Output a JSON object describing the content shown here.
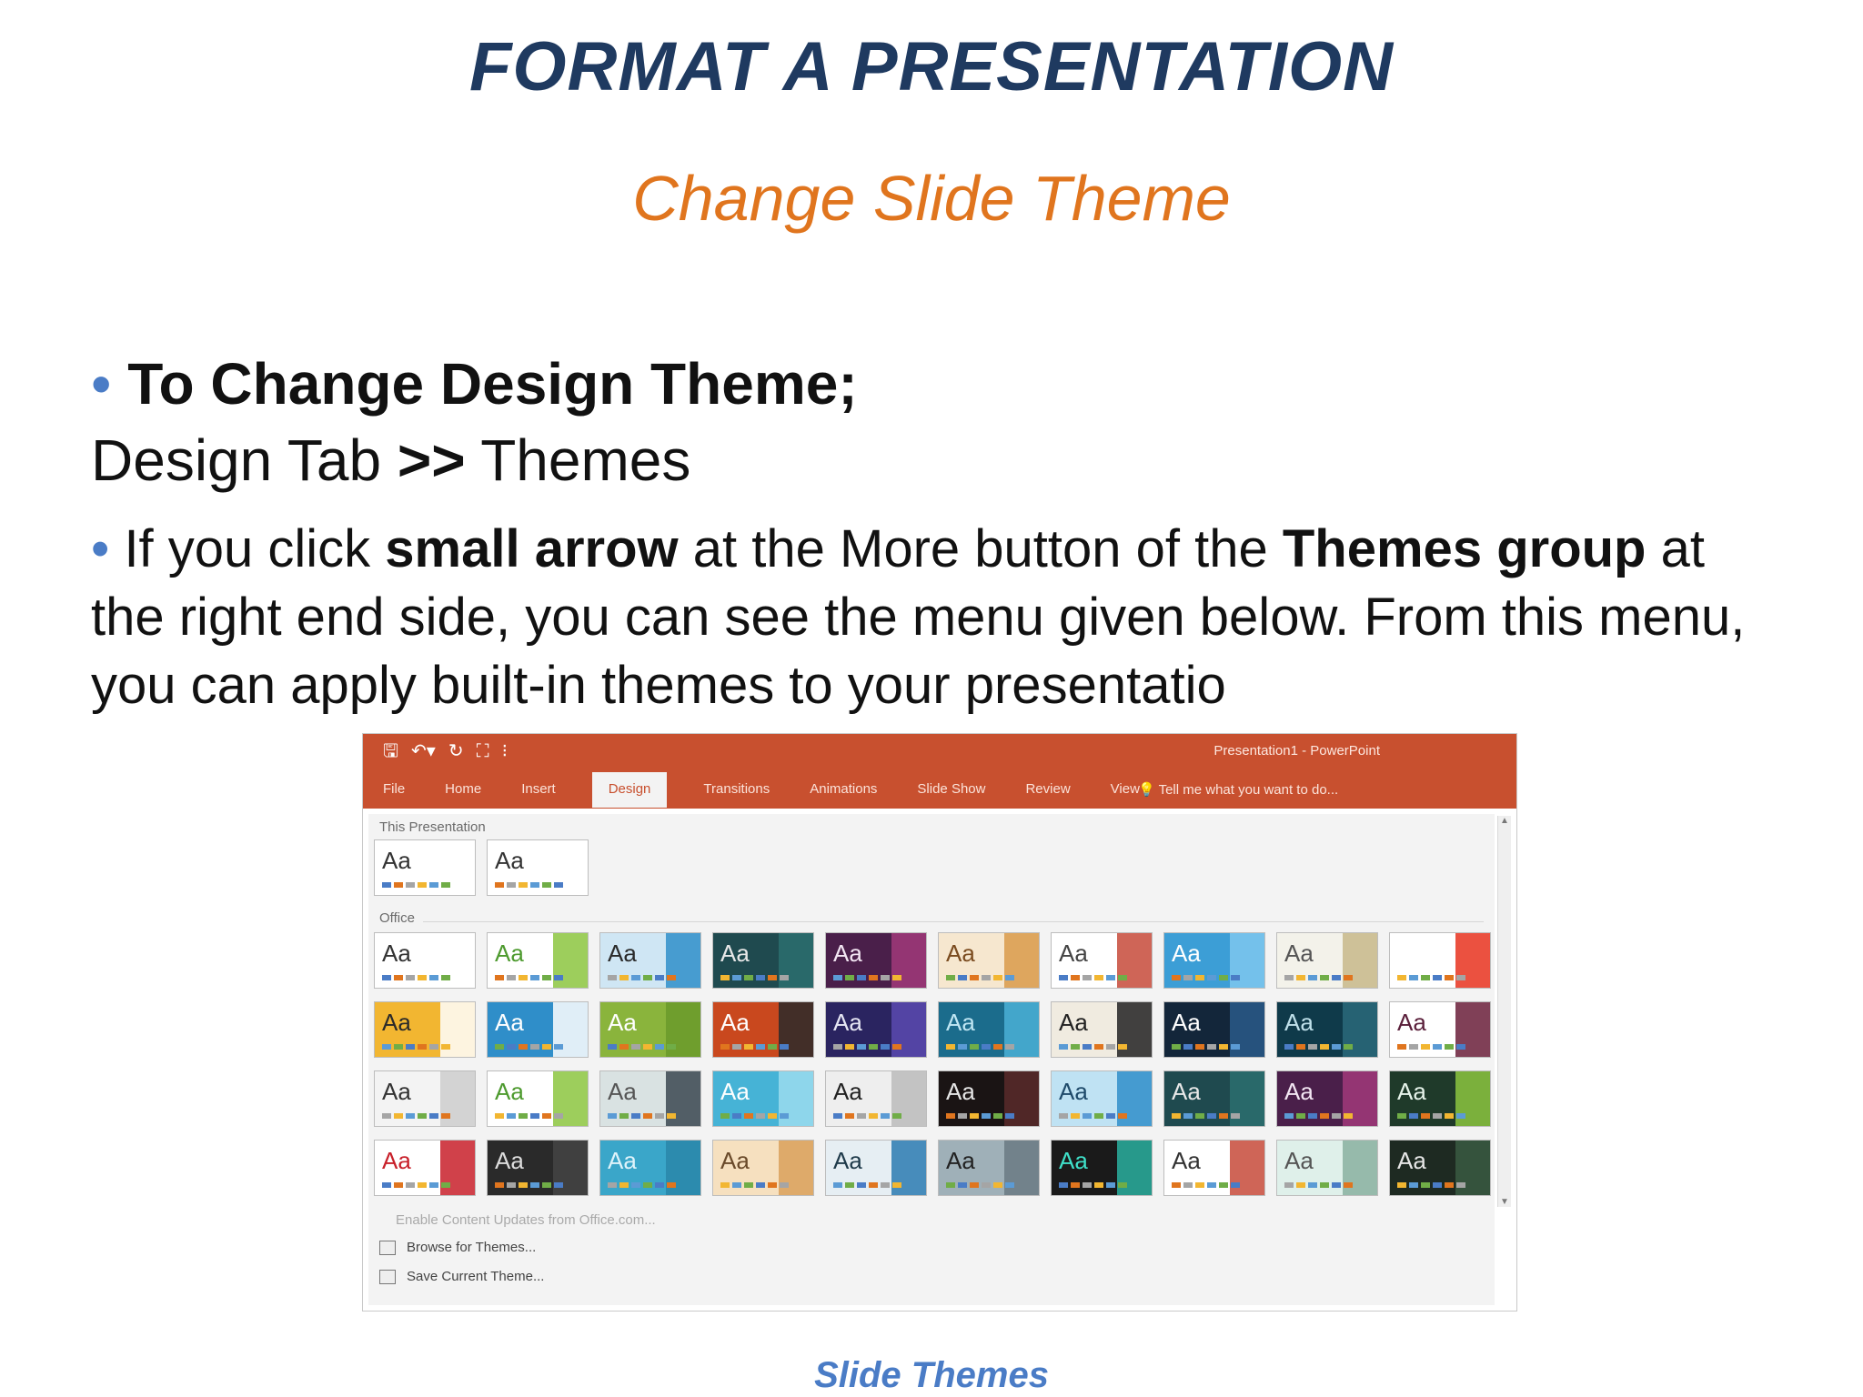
{
  "slide": {
    "title": "FORMAT A PRESENTATION",
    "subtitle": "Change Slide Theme",
    "bullet_char": "•",
    "bullet1": {
      "heading": "To Change Design Theme;",
      "path_a": "Design Tab ",
      "path_sep": ">>",
      "path_b": " Themes"
    },
    "bullet2": {
      "t1": " If you click ",
      "b1": "small arrow",
      "t2": " at the More button of the ",
      "b2": "Themes group",
      "t3": " at the right end side, you can see the menu given below. From this menu, you can apply built-in themes to your presentatio"
    },
    "caption": "Slide Themes"
  },
  "screenshot": {
    "window_title": "Presentation1 - PowerPoint",
    "qat_icons": [
      "save-icon",
      "undo-icon",
      "redo-icon",
      "start-from-beginning-icon",
      "customize-qat-icon"
    ],
    "qat_glyphs": [
      "🖫",
      "↶▾",
      "↻",
      "⛶",
      "⁝"
    ],
    "tabs": [
      "File",
      "Home",
      "Insert",
      "Design",
      "Transitions",
      "Animations",
      "Slide Show",
      "Review",
      "View"
    ],
    "active_tab": "Design",
    "tell_me": "💡 Tell me what you want to do...",
    "sections": {
      "this_presentation": "This Presentation",
      "office": "Office"
    },
    "theme_label": "Aa",
    "this_presentation_themes": [
      {
        "bg": "#ffffff",
        "fg": "#333333"
      },
      {
        "bg": "#ffffff",
        "fg": "#333333"
      }
    ],
    "office_themes": [
      {
        "bg": "#ffffff",
        "fg": "#333333",
        "accent": "#ffffff"
      },
      {
        "bg": "#ffffff",
        "fg": "#4d9a2e",
        "accent": "#8cc63f"
      },
      {
        "bg": "#cfe6f4",
        "fg": "#2a2a2a",
        "accent": "#2f8ec9"
      },
      {
        "bg": "#1f4a4f",
        "fg": "#e8e8e8",
        "accent": "#2c6e6e"
      },
      {
        "bg": "#4a1f4a",
        "fg": "#f3e6f3",
        "accent": "#a13a7a"
      },
      {
        "bg": "#f6e7cf",
        "fg": "#7a4b1f",
        "accent": "#d99a4a"
      },
      {
        "bg": "#ffffff",
        "fg": "#444444",
        "accent": "#c74a3a"
      },
      {
        "bg": "#3c9ed6",
        "fg": "#ffffff",
        "accent": "#7ec7ef"
      },
      {
        "bg": "#f3f2ea",
        "fg": "#555555",
        "accent": "#c7b98a"
      },
      {
        "bg": "#ffffff",
        "fg": "#ffffff",
        "accent": "#e8321e"
      },
      {
        "bg": "#f2b631",
        "fg": "#2a2a2a",
        "accent": "#ffffff"
      },
      {
        "bg": "#2f8ec9",
        "fg": "#ffffff",
        "accent": "#ffffff"
      },
      {
        "bg": "#8ab43c",
        "fg": "#ffffff",
        "accent": "#6a9a2a"
      },
      {
        "bg": "#c9481e",
        "fg": "#ffffff",
        "accent": "#2a2a2a"
      },
      {
        "bg": "#2a2460",
        "fg": "#e6e6f3",
        "accent": "#5a4ab0"
      },
      {
        "bg": "#1b6c8c",
        "fg": "#bfe6f3",
        "accent": "#4ab0d6"
      },
      {
        "bg": "#f0ebe0",
        "fg": "#222222",
        "accent": "#222222"
      },
      {
        "bg": "#13263a",
        "fg": "#ffffff",
        "accent": "#2a5a8a"
      },
      {
        "bg": "#0f3a4a",
        "fg": "#bfe0ea",
        "accent": "#2a6a7a"
      },
      {
        "bg": "#ffffff",
        "fg": "#5a1f3a",
        "accent": "#6a1f3a"
      },
      {
        "bg": "#f3f3f3",
        "fg": "#333333",
        "accent": "#cccccc"
      },
      {
        "bg": "#ffffff",
        "fg": "#4d9a2e",
        "accent": "#8cc63f"
      },
      {
        "bg": "#d9e2e2",
        "fg": "#555555",
        "accent": "#3a4650"
      },
      {
        "bg": "#46b3d6",
        "fg": "#ffffff",
        "accent": "#9bdcef"
      },
      {
        "bg": "#eeeeee",
        "fg": "#222222",
        "accent": "#bbbbbb"
      },
      {
        "bg": "#1a1414",
        "fg": "#e6e6e6",
        "accent": "#5a2a2a"
      },
      {
        "bg": "#bfe2f3",
        "fg": "#1f4a6a",
        "accent": "#2f8ec9"
      },
      {
        "bg": "#1f4a4f",
        "fg": "#e8e8e8",
        "accent": "#2c6e6e"
      },
      {
        "bg": "#4a1f4a",
        "fg": "#f3e6f3",
        "accent": "#a13a7a"
      },
      {
        "bg": "#1f3a2a",
        "fg": "#e6f3ea",
        "accent": "#8cc63f"
      },
      {
        "bg": "#ffffff",
        "fg": "#c8202a",
        "accent": "#c8202a"
      },
      {
        "bg": "#2a2a2a",
        "fg": "#dddddd",
        "accent": "#444444"
      },
      {
        "bg": "#3aa6c9",
        "fg": "#dff3fa",
        "accent": "#2a86a9"
      },
      {
        "bg": "#f6e0bf",
        "fg": "#6a4a2a",
        "accent": "#d9a05a"
      },
      {
        "bg": "#e6eef3",
        "fg": "#1f3a4a",
        "accent": "#2a7ab0"
      },
      {
        "bg": "#9fb0b8",
        "fg": "#222222",
        "accent": "#6a7a82"
      },
      {
        "bg": "#1a1a1a",
        "fg": "#3fe0c9",
        "accent": "#2ab0a0"
      },
      {
        "bg": "#ffffff",
        "fg": "#333333",
        "accent": "#c74a3a"
      },
      {
        "bg": "#dff0ea",
        "fg": "#555555",
        "accent": "#8ab0a0"
      },
      {
        "bg": "#1e2a22",
        "fg": "#e6e6e6",
        "accent": "#3a5a42"
      }
    ],
    "strip_colors": [
      "#4a7cc6",
      "#e0751e",
      "#a5a5a5",
      "#f2b631",
      "#5b9bd5",
      "#70ad47"
    ],
    "menu": {
      "enable_updates": "Enable Content Updates from Office.com...",
      "browse": "Browse for Themes...",
      "save": "Save Current Theme..."
    }
  }
}
